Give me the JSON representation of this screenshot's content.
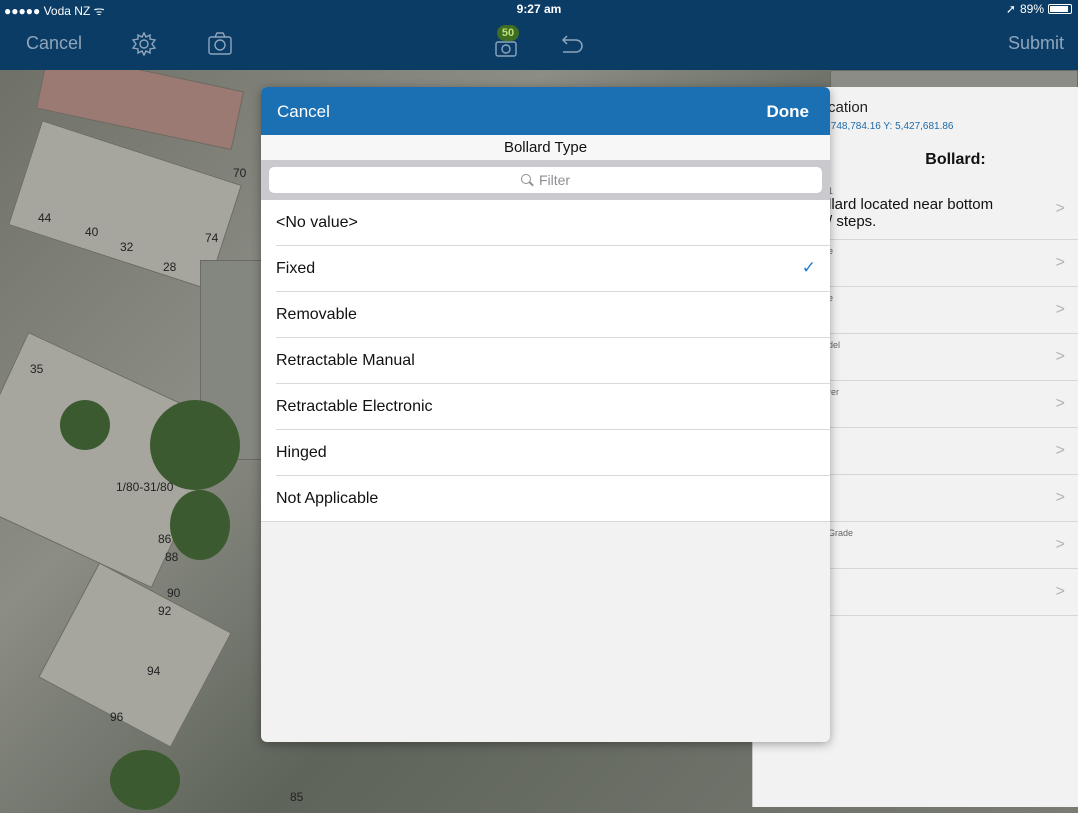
{
  "status": {
    "carrier": "●●●●● Voda NZ ᯤ",
    "time": "9:27 am",
    "location_arrow": "➚",
    "battery": "89%",
    "battery_level": 0.89
  },
  "toolbar": {
    "cancel": "Cancel",
    "submit": "Submit",
    "badge_count": "50",
    "icons": [
      "gear-icon",
      "camera-icon",
      "photo-capture-icon",
      "undo-icon"
    ]
  },
  "map": {
    "labels": [
      "70",
      "44",
      "40",
      "32",
      "74",
      "28",
      "35",
      "1/80-31/80",
      "86",
      "88",
      "90",
      "92",
      "94",
      "96",
      "85"
    ]
  },
  "panel": {
    "location_title": "cation",
    "location_coords": ",748,784.16 Y: 5,427,681.86",
    "title": "Bollard:",
    "rows": [
      {
        "label": "1",
        "value": "llard located near bottom\n/ steps."
      },
      {
        "label": "e",
        "value": ""
      },
      {
        "label": "e",
        "value": ""
      },
      {
        "label": "del",
        "value": ""
      },
      {
        "label": "rer",
        "value": ""
      },
      {
        "label": "",
        "value": ""
      },
      {
        "label": "",
        "value": ""
      },
      {
        "label": "Grade",
        "value": ""
      },
      {
        "label": "",
        "value": ""
      }
    ]
  },
  "popover": {
    "cancel": "Cancel",
    "done": "Done",
    "title": "Bollard Type",
    "filter_placeholder": "Filter",
    "selected": "Fixed",
    "options": [
      "<No value>",
      "Fixed",
      "Removable",
      "Retractable Manual",
      "Retractable Electronic",
      "Hinged",
      "Not Applicable"
    ]
  },
  "colors": {
    "nav_bar": "#0b3c66",
    "popover_header": "#1b6fb3",
    "check": "#1f7fd6",
    "badge": "#3f6d21"
  }
}
